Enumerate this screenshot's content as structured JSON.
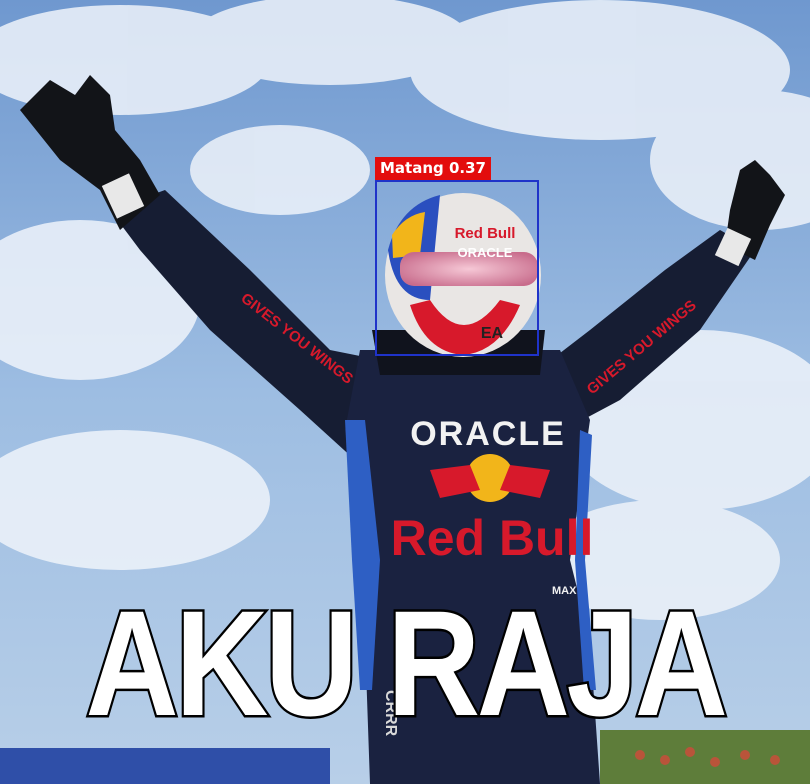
{
  "detection": {
    "label": "Matang 0.37",
    "box_color": "#1f33c9",
    "label_bg": "#e30d0d"
  },
  "caption": "AKU RAJA",
  "printed_text": {
    "suit_brand_1": "ORACLE",
    "suit_brand_2": "Red Bull",
    "sleeve_slogan": "GIVES YOU WINGS",
    "helmet_brand_1": "Red Bull",
    "helmet_brand_2": "ORACLE",
    "helmet_brand_3": "EA",
    "leg_text": "CRRR",
    "chest_tag": "MAX"
  },
  "colors": {
    "sky": "#8fb3dc",
    "suit": "#161d33",
    "accent_red": "#d7192b",
    "accent_yellow": "#f2b51a"
  }
}
